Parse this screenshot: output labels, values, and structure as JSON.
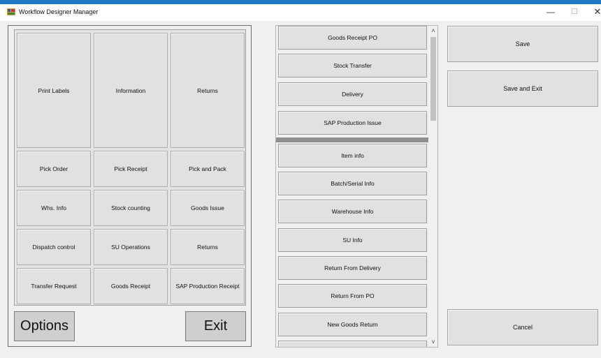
{
  "window": {
    "title": "Workflow Designer Manager",
    "minimize_glyph": "—",
    "maximize_glyph": "☐",
    "close_glyph": "✕"
  },
  "grid_buttons": [
    {
      "id": "print-labels",
      "label": "Print Labels"
    },
    {
      "id": "information",
      "label": "Information"
    },
    {
      "id": "returns-top",
      "label": "Returns"
    },
    {
      "id": "pick-order",
      "label": "Pick Order"
    },
    {
      "id": "pick-receipt",
      "label": "Pick Receipt"
    },
    {
      "id": "pick-and-pack",
      "label": "Pick and Pack"
    },
    {
      "id": "whs-info",
      "label": "Whs. Info"
    },
    {
      "id": "stock-counting",
      "label": "Stock counting"
    },
    {
      "id": "goods-issue",
      "label": "Goods Issue"
    },
    {
      "id": "dispatch-control",
      "label": "Dispatch control"
    },
    {
      "id": "su-operations",
      "label": "SU Operations"
    },
    {
      "id": "returns-bottom",
      "label": "Returns"
    },
    {
      "id": "transfer-request",
      "label": "Transfer Request"
    },
    {
      "id": "goods-receipt",
      "label": "Goods Receipt"
    },
    {
      "id": "sap-production-receipt",
      "label": "SAP Production Receipt"
    }
  ],
  "bottom_buttons": {
    "options": "Options",
    "exit": "Exit"
  },
  "workflow_list": [
    "Goods Receipt PO",
    "Stock Transfer",
    "Delivery",
    "SAP Production Issue",
    "Item info",
    "Batch/Serial Info",
    "Warehouse Info",
    "SU Info",
    "Return From Delivery",
    "Return From PO",
    "New Goods Return"
  ],
  "scroll": {
    "up_glyph": "˄",
    "down_glyph": "˅"
  },
  "actions": {
    "save": "Save",
    "save_and_exit": "Save and Exit",
    "cancel": "Cancel"
  }
}
